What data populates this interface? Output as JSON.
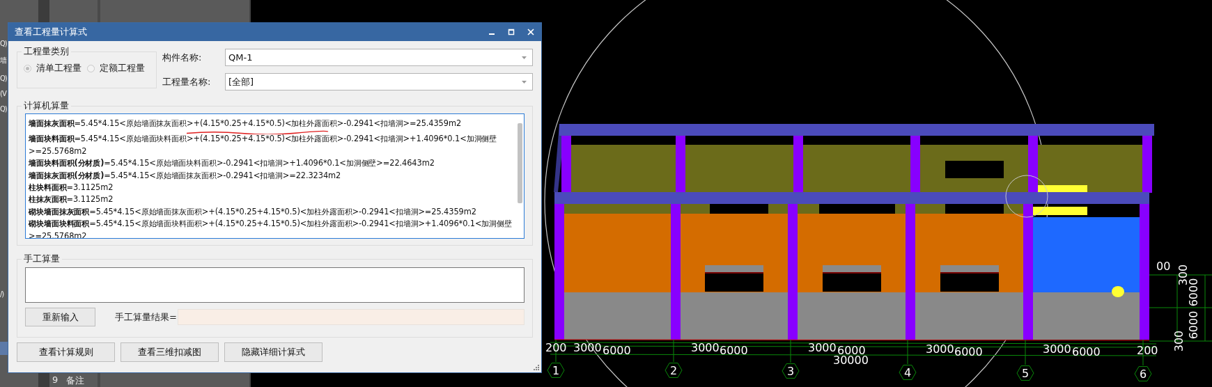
{
  "left_panel": {
    "fragments": [
      "Q)",
      "墙",
      "Q)",
      "(V",
      "Q)",
      "/)"
    ],
    "rows": [
      {
        "number": "9",
        "label": "备注"
      }
    ]
  },
  "viewport": {
    "dimension_labels": [
      "200",
      "3000",
      "6000",
      "3000",
      "6000",
      "3000",
      "6000",
      "30000",
      "3000",
      "6000",
      "3000",
      "6000",
      "200",
      "00",
      "300",
      "6000",
      "6000",
      "300"
    ],
    "axis_labels": [
      "1",
      "2",
      "3",
      "4",
      "5",
      "6"
    ]
  },
  "dialog": {
    "title": "查看工程量计算式",
    "category_group": {
      "title": "工程量类别",
      "disabled": true,
      "options": [
        {
          "label": "清单工程量",
          "selected": true
        },
        {
          "label": "定额工程量",
          "selected": false
        }
      ]
    },
    "fields": [
      {
        "label": "构件名称:",
        "value": "QM-1"
      },
      {
        "label": "工程量名称:",
        "value": "[全部]"
      }
    ],
    "computed_group": {
      "title": "计算机算量",
      "lines": [
        "**墙面抹灰面积**=5.45*4.15<原始墙面抹灰面积>+(4.15*0.25+4.15*0.5)<加柱外露面积>-0.2941<扣墙洞>=25.4359m2",
        "**墙面块料面积**=5.45*4.15<原始墙面块料面积>+(4.15*0.25+4.15*0.5)<加柱外露面积>-0.2941<扣墙洞>+1.4096*0.1<加洞侧壁>=25.5768m2",
        "**墙面块料面积(分材质)**=5.45*4.15<原始墙面块料面积>-0.2941<扣墙洞>+1.4096*0.1<加洞侧壁>=22.4643m2",
        "**墙面抹灰面积(分材质)**=5.45*4.15<原始墙面抹灰面积>-0.2941<扣墙洞>=22.3234m2",
        "**柱块料面积**=3.1125m2",
        "**柱抹灰面积**=3.1125m2",
        "**砌块墙面抹灰面积**=5.45*4.15<原始墙面抹灰面积>+(4.15*0.25+4.15*0.5)<加柱外露面积>-0.2941<扣墙洞>=25.4359m2",
        "**砌块墙面块料面积**=5.45*4.15<原始墙面块料面积>+(4.15*0.25+4.15*0.5)<加柱外露面积>-0.2941<扣墙洞>+1.4096*0.1<加洞侧壁>=25.5768m2"
      ]
    },
    "manual_group": {
      "title": "手工算量",
      "reenter_button": "重新输入",
      "result_label": "手工算量结果="
    },
    "buttons": [
      "查看计算规则",
      "查看三维扣减图",
      "隐藏详细计算式"
    ]
  }
}
